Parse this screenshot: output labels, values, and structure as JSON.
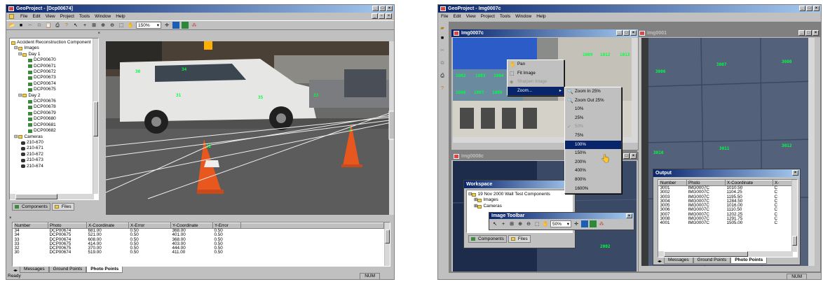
{
  "left": {
    "title": "GeoProject - [Dcp00674]",
    "menu": [
      "File",
      "Edit",
      "View",
      "Project",
      "Tools",
      "Window",
      "Help"
    ],
    "zoom": "150%",
    "tree_root": "Accident Reconstruction Component",
    "images_folder": "Images",
    "day1": "Day 1",
    "day1_items": [
      "DCP00670",
      "DCP00671",
      "DCP00672",
      "DCP00673",
      "DCP00674",
      "DCP00675"
    ],
    "day2": "Day 2",
    "day2_items": [
      "DCP00676",
      "DCP00678",
      "DCP00679",
      "DCP00680",
      "DCP00681",
      "DCP00682"
    ],
    "cameras_folder": "Cameras",
    "cameras": [
      "210-670",
      "210-671",
      "210-672",
      "210-673",
      "210-674"
    ],
    "panel_tabs": [
      "Components",
      "Files"
    ],
    "table_headers": [
      "Number",
      "Photo",
      "X-Coordinate",
      "X-Error",
      "Y-Coordinate",
      "Y-Error"
    ],
    "rows": [
      [
        "34",
        "DCP00674",
        "681.00",
        "0.50",
        "368.00",
        "0.50"
      ],
      [
        "34",
        "DCP00675",
        "521.00",
        "0.50",
        "401.00",
        "0.50"
      ],
      [
        "33",
        "DCP00674",
        "608.00",
        "0.50",
        "368.00",
        "0.50"
      ],
      [
        "33",
        "DCP00675",
        "414.00",
        "0.50",
        "403.00",
        "0.50"
      ],
      [
        "32",
        "DCP00675",
        "370.00",
        "0.50",
        "444.00",
        "0.50"
      ],
      [
        "30",
        "DCP00674",
        "519.00",
        "0.50",
        "411.00",
        "0.50"
      ]
    ],
    "bottom_tabs": [
      "Messages",
      "Ground Points",
      "Photo Points"
    ],
    "status": "Ready",
    "status_num": "NUM",
    "photo_labels": [
      "30",
      "34",
      "31",
      "35",
      "33",
      "32",
      "1",
      "2"
    ]
  },
  "right": {
    "title": "GeoProject - Img0007c",
    "menu": [
      "File",
      "Edit",
      "View",
      "Project",
      "Tools",
      "Window",
      "Help"
    ],
    "child1_title": "Img0007c",
    "child2_title": "Img0001",
    "child3_title": "Img0008c",
    "ctx_items": [
      "Pan",
      "Fit Image",
      "Sharpen Image",
      "Zoom..."
    ],
    "zoom_items": [
      "Zoom In 25%",
      "Zoom Out 25%",
      "10%",
      "25%",
      "50%",
      "75%",
      "100%",
      "150%",
      "200%",
      "400%",
      "800%",
      "1600%"
    ],
    "workspace_title": "Workspace",
    "workspace_root": "19 Nov 2000 Wall Test Components",
    "workspace_items": [
      "Images",
      "Cameras"
    ],
    "image_toolbar_title": "Image Toolbar",
    "image_toolbar_zoom": "50%",
    "workspace_tabs": [
      "Components",
      "Files"
    ],
    "output_title": "Output",
    "out_headers": [
      "Number",
      "Photo",
      "X-Coordinate",
      "X-"
    ],
    "out_rows": [
      [
        "3001",
        "IMG0007C",
        "1010.50",
        "C"
      ],
      [
        "3002",
        "IMG0007C",
        "1104.25",
        "C"
      ],
      [
        "3003",
        "IMG0007C",
        "1195.50",
        "C"
      ],
      [
        "3004",
        "IMG0007C",
        "1284.50",
        "C"
      ],
      [
        "3005",
        "IMG0007C",
        "1016.00",
        "C"
      ],
      [
        "3006",
        "IMG0007C",
        "1110.50",
        "C"
      ],
      [
        "3007",
        "IMG0007C",
        "1202.25",
        "C"
      ],
      [
        "3008",
        "IMG0007C",
        "1291.75",
        "C"
      ],
      [
        "4001",
        "IMG0007C",
        "1505.00",
        "C"
      ]
    ],
    "out_tabs": [
      "Messages",
      "Ground Points",
      "Photo Points"
    ],
    "status_num": "NUM",
    "c1_labels": [
      "1002",
      "1003",
      "1004",
      "1006",
      "1007",
      "1008",
      "1009",
      "1012",
      "1013"
    ],
    "c2_labels": [
      "3006",
      "3007",
      "3008",
      "3010",
      "3011",
      "3012"
    ],
    "c3_labels": [
      "2001",
      "2002"
    ]
  },
  "colors": {
    "title_start": "#08246b",
    "title_end": "#a6caf0",
    "chrome": "#c0c0c0",
    "marker": "#00ff40",
    "selection": "#08246b"
  }
}
